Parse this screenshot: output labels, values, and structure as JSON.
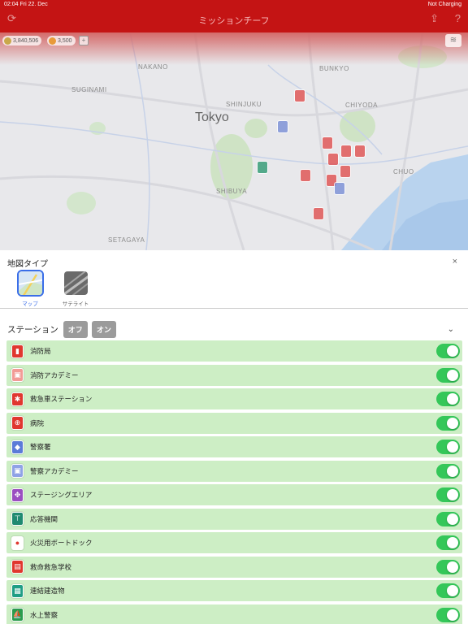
{
  "status_bar": {
    "time_date": "02:04   Fri 22. Dec",
    "battery": "Not Charging"
  },
  "header": {
    "title": "ミッションチーフ"
  },
  "currency": {
    "credits": "3,840,506",
    "coins": "3,500",
    "add": "+"
  },
  "map": {
    "labels": {
      "tokyo": "Tokyo",
      "nakano": "NAKANO",
      "suginami": "SUGINAMI",
      "shinjuku": "SHINJUKU",
      "bunkyo": "BUNKYO",
      "chiyoda": "CHIYODA",
      "shibuya": "SHIBUYA",
      "setagaya": "SETAGAYA",
      "chuo": "CHUO"
    }
  },
  "maptype": {
    "title": "地図タイプ",
    "close": "×",
    "options": [
      {
        "label": "マップ",
        "selected": true
      },
      {
        "label": "サテライト",
        "selected": false
      }
    ]
  },
  "stations": {
    "title": "ステーション",
    "off_label": "オフ",
    "on_label": "オン",
    "items": [
      {
        "label": "消防局",
        "icon": "fire-station-icon",
        "color": "#e0372f",
        "glyph": "▮",
        "enabled": true
      },
      {
        "label": "消防アカデミー",
        "icon": "fire-academy-icon",
        "color": "#f29b96",
        "glyph": "▣",
        "enabled": true
      },
      {
        "label": "救急車ステーション",
        "icon": "ambulance-station-icon",
        "color": "#e0372f",
        "glyph": "✱",
        "enabled": true
      },
      {
        "label": "病院",
        "icon": "hospital-icon",
        "color": "#e0372f",
        "glyph": "⊕",
        "enabled": true
      },
      {
        "label": "警察署",
        "icon": "police-station-icon",
        "color": "#5b7bd8",
        "glyph": "◆",
        "enabled": true
      },
      {
        "label": "警察アカデミー",
        "icon": "police-academy-icon",
        "color": "#8fa2e6",
        "glyph": "▣",
        "enabled": true
      },
      {
        "label": "ステージングエリア",
        "icon": "staging-area-icon",
        "color": "#9b4fc1",
        "glyph": "✥",
        "enabled": true
      },
      {
        "label": "応答機関",
        "icon": "dispatch-center-icon",
        "color": "#1f8a70",
        "glyph": "⊤",
        "enabled": true
      },
      {
        "label": "火災用ボートドック",
        "icon": "fire-boat-dock-icon",
        "color": "#ffffff",
        "glyph": "●",
        "enabled": true
      },
      {
        "label": "救命救急学校",
        "icon": "ems-school-icon",
        "color": "#e0372f",
        "glyph": "▤",
        "enabled": true
      },
      {
        "label": "連結建造物",
        "icon": "connected-building-icon",
        "color": "#1f9e85",
        "glyph": "▦",
        "enabled": true
      },
      {
        "label": "水上警察",
        "icon": "water-police-icon",
        "color": "#2a9c4e",
        "glyph": "⛵",
        "enabled": true
      }
    ]
  }
}
